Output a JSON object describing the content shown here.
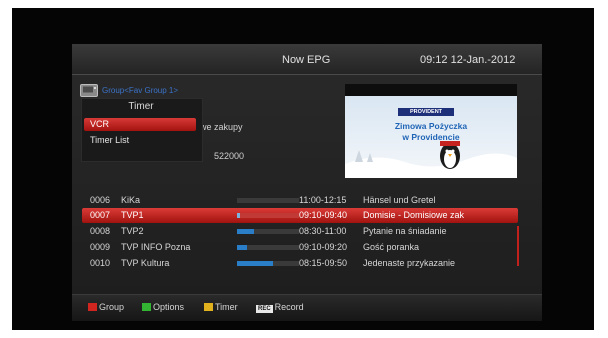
{
  "header": {
    "title": "Now EPG",
    "clock": "09:12 12-Jan.-2012"
  },
  "group": {
    "label": "Group<Fav Group 1>",
    "icon": "tv-folder-icon"
  },
  "popup": {
    "title": "Timer",
    "items": [
      {
        "label": "VCR",
        "selected": true
      },
      {
        "label": "Timer List",
        "selected": false
      }
    ]
  },
  "info": {
    "line1": "we zakupy",
    "line2": "522000"
  },
  "preview": {
    "logo": "PROVIDENT",
    "line1": "Zimowa Pożyczka",
    "line2": "w Providencie"
  },
  "channels": [
    {
      "num": "0006",
      "name": "KiKa",
      "progress": 0.0,
      "time": "11:00-12:15",
      "program": "Hänsel und Gretel",
      "selected": false
    },
    {
      "num": "0007",
      "name": "TVP1",
      "progress": 0.05,
      "time": "09:10-09:40",
      "program": "Domisie - Domisiowe zak",
      "selected": true
    },
    {
      "num": "0008",
      "name": "TVP2",
      "progress": 0.27,
      "time": "08:30-11:00",
      "program": "Pytanie na śniadanie",
      "selected": false
    },
    {
      "num": "0009",
      "name": "TVP INFO Pozna",
      "progress": 0.16,
      "time": "09:10-09:20",
      "program": "Gość poranka",
      "selected": false
    },
    {
      "num": "0010",
      "name": "TVP Kultura",
      "progress": 0.58,
      "time": "08:15-09:50",
      "program": "Jedenaste przykazanie",
      "selected": false
    }
  ],
  "footer": {
    "keys": [
      {
        "label": "Group",
        "color": "#d0261f"
      },
      {
        "label": "Options",
        "color": "#33b533"
      },
      {
        "label": "Timer",
        "color": "#e2b21e"
      },
      {
        "label": "Record",
        "badge": "REC"
      }
    ]
  },
  "colors": {
    "accent": "#c8201c",
    "text": "#d7d7d7",
    "group_label": "#3b73c8"
  }
}
